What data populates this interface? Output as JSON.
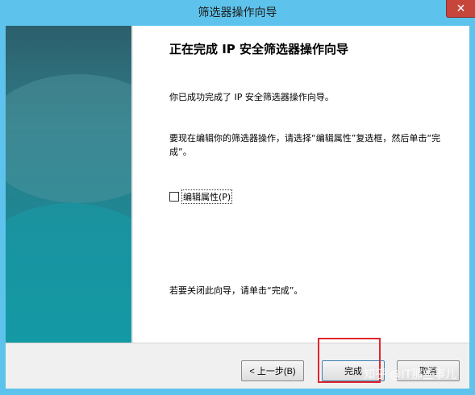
{
  "window": {
    "title": "筛选器操作向导",
    "close_glyph": "✕"
  },
  "main": {
    "heading": "正在完成 IP 安全筛选器操作向导",
    "success_text": "你已成功完成了 IP 安全筛选器操作向导。",
    "edit_instruction": "要现在编辑你的筛选器操作，请选择“编辑属性”复选框，然后单击“完成”。",
    "checkbox_label": "编辑属性(P)",
    "checkbox_checked": false,
    "close_instruction": "若要关闭此向导，请单击“完成”。"
  },
  "buttons": {
    "back": "< 上一步(B)",
    "finish": "完成",
    "cancel": "取消"
  },
  "overlay": {
    "watermark": "知乎 @IT那些事儿",
    "highlight_color": "#e0262b"
  },
  "colors": {
    "titlebar": "#5ec3ec",
    "banner": "#1b8a97"
  }
}
